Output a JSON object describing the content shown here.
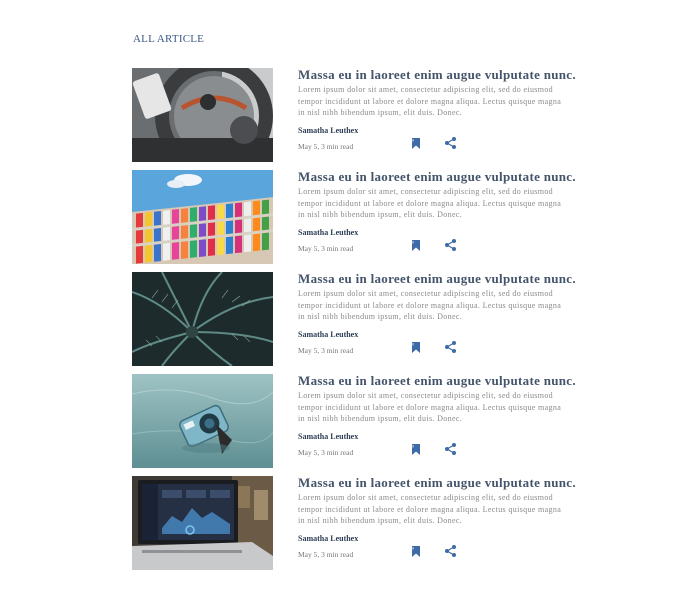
{
  "section": {
    "title": "ALL ARTICLE"
  },
  "colors": {
    "accent": "#3f6aa8",
    "title": "#44546a"
  },
  "articles": [
    {
      "image": "car-dashboard-photo",
      "title": "Massa eu in laoreet enim augue vulputate nunc.",
      "excerpt": "Lorem ipsum dolor sit amet, consectetur adipiscing elit, sed do eiusmod tempor incididunt ut labore et dolore magna aliqua. Lectus quisque magna in nisl nibh bibendum ipsum, elit duis. Donec.",
      "author": "Samatha Leuthex",
      "meta": "May 5, 3 min read",
      "bookmark_icon": "bookmark-icon",
      "share_icon": "share-icon"
    },
    {
      "image": "colorful-building-facade-photo",
      "title": "Massa eu in laoreet enim augue vulputate nunc.",
      "excerpt": "Lorem ipsum dolor sit amet, consectetur adipiscing elit, sed do eiusmod tempor incididunt ut labore et dolore magna aliqua. Lectus quisque magna in nisl nibh bibendum ipsum, elit duis. Donec.",
      "author": "Samatha Leuthex",
      "meta": "May 5, 3 min read",
      "bookmark_icon": "bookmark-icon",
      "share_icon": "share-icon"
    },
    {
      "image": "palm-leaves-photo",
      "title": "Massa eu in laoreet enim augue vulputate nunc.",
      "excerpt": "Lorem ipsum dolor sit amet, consectetur adipiscing elit, sed do eiusmod tempor incididunt ut labore et dolore magna aliqua. Lectus quisque magna in nisl nibh bibendum ipsum, elit duis. Donec.",
      "author": "Samatha Leuthex",
      "meta": "May 5, 3 min read",
      "bookmark_icon": "bookmark-icon",
      "share_icon": "share-icon"
    },
    {
      "image": "underwater-camera-photo",
      "title": "Massa eu in laoreet enim augue vulputate nunc.",
      "excerpt": "Lorem ipsum dolor sit amet, consectetur adipiscing elit, sed do eiusmod tempor incididunt ut labore et dolore magna aliqua. Lectus quisque magna in nisl nibh bibendum ipsum, elit duis. Donec.",
      "author": "Samatha Leuthex",
      "meta": "May 5, 3 min read",
      "bookmark_icon": "bookmark-icon",
      "share_icon": "share-icon"
    },
    {
      "image": "laptop-dashboard-photo",
      "title": "Massa eu in laoreet enim augue vulputate nunc.",
      "excerpt": "Lorem ipsum dolor sit amet, consectetur adipiscing elit, sed do eiusmod tempor incididunt ut labore et dolore magna aliqua. Lectus quisque magna in nisl nibh bibendum ipsum, elit duis. Donec.",
      "author": "Samatha Leuthex",
      "meta": "May 5, 3 min read",
      "bookmark_icon": "bookmark-icon",
      "share_icon": "share-icon"
    }
  ]
}
